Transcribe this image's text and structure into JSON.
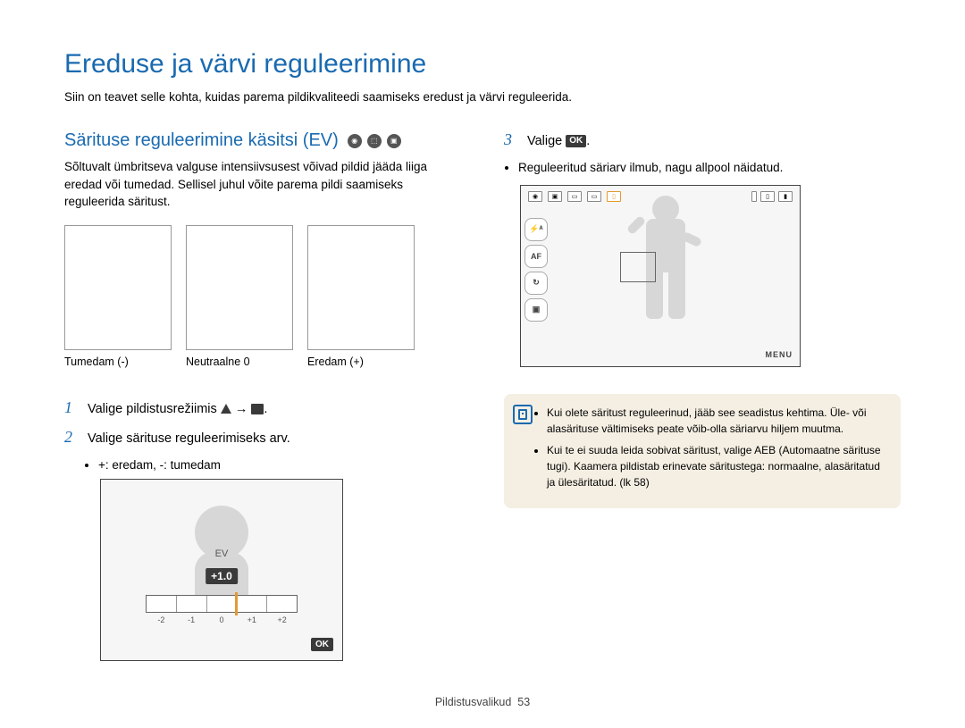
{
  "title": "Ereduse ja värvi reguleerimine",
  "intro": "Siin on teavet selle kohta, kuidas parema pildikvaliteedi saamiseks eredust ja värvi reguleerida.",
  "section_title": "Särituse reguleerimine käsitsi (EV)",
  "section_desc": "Sõltuvalt ümbritseva valguse intensiivsusest võivad pildid jääda liiga eredad või tumedad. Sellisel juhul võite parema pildi saamiseks reguleerida säritust.",
  "thumbs": [
    {
      "label": "Tumedam (-)"
    },
    {
      "label": "Neutraalne 0"
    },
    {
      "label": "Eredam (+)"
    }
  ],
  "step1": "Valige pildistusrežiimis",
  "step1_arrow": "→",
  "step2": "Valige särituse reguleerimiseks arv.",
  "step2_bullet": "+: eredam, -: tumedam",
  "ev_label": "EV",
  "ev_value": "+1.0",
  "ev_ticks": [
    "-2",
    "-1",
    "0",
    "+1",
    "+2"
  ],
  "ev_ok": "OK",
  "step3_prefix": "Valige",
  "step3_bullet": "Reguleeritud säriarv ilmub, nagu allpool näidatud.",
  "cam_left": [
    "⚡ᴬ",
    "AF",
    "↻",
    "▣"
  ],
  "cam_menu": "MENU",
  "note_bullets": [
    "Kui olete säritust reguleerinud, jääb see seadistus kehtima. Üle- või alasärituse vältimiseks peate võib-olla säriarvu hiljem muutma.",
    "Kui te ei suuda leida sobivat säritust, valige AEB (Automaatne särituse tugi). Kaamera pildistab erinevate säritustega: normaalne, alasäritatud ja ülesäritatud. (lk 58)"
  ],
  "footer_section": "Pildistusvalikud",
  "footer_page": "53"
}
